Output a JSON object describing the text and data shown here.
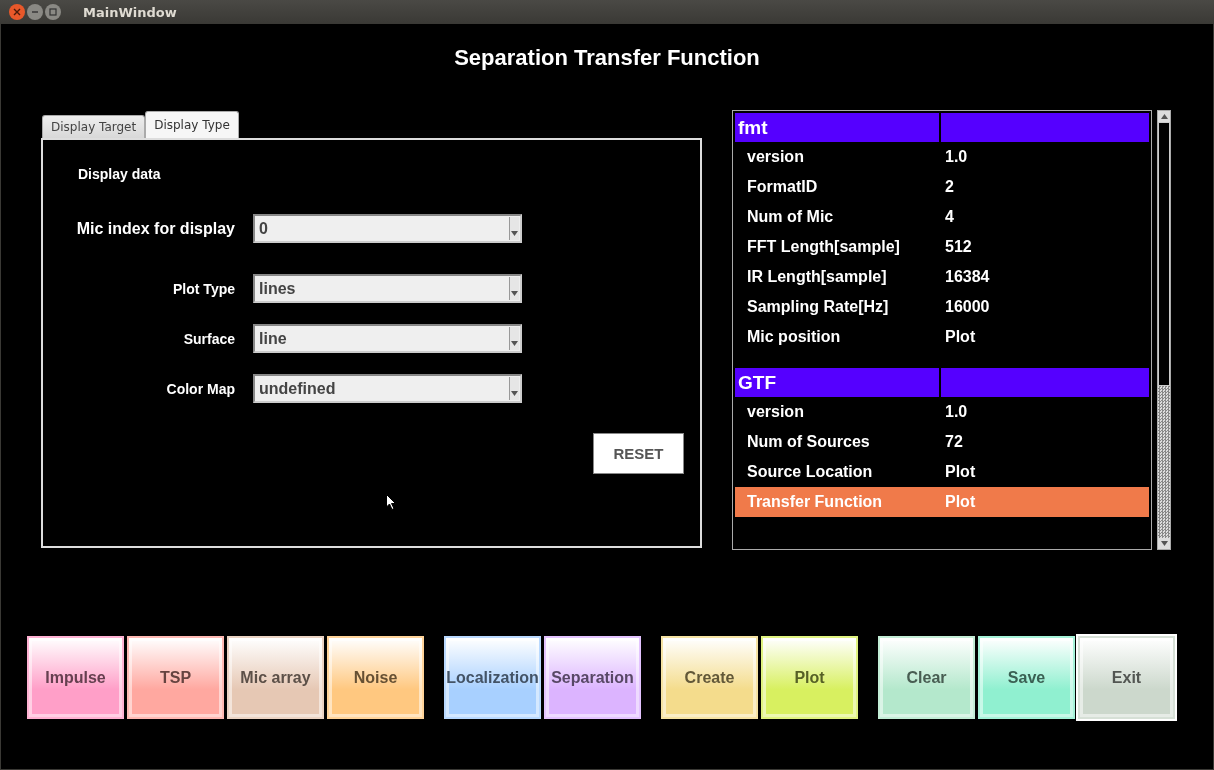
{
  "window": {
    "title": "MainWindow"
  },
  "heading": "Separation Transfer Function",
  "tabs": [
    {
      "label": "Display Target",
      "selected": false
    },
    {
      "label": "Display Type",
      "selected": true
    }
  ],
  "panel": {
    "section_label": "Display data",
    "fields": [
      {
        "label": "Mic index for display",
        "value": "0",
        "large": true
      },
      {
        "label": "Plot Type",
        "value": "lines",
        "large": false
      },
      {
        "label": "Surface",
        "value": "line",
        "large": false
      },
      {
        "label": "Color Map",
        "value": "undefined",
        "large": false
      }
    ],
    "reset_button": "RESET"
  },
  "table": {
    "sections": [
      {
        "title": "fmt",
        "rows": [
          {
            "name": "version",
            "value": "1.0",
            "selected": false
          },
          {
            "name": "FormatID",
            "value": "2",
            "selected": false
          },
          {
            "name": "Num of Mic",
            "value": "4",
            "selected": false
          },
          {
            "name": "FFT Length[sample]",
            "value": "512",
            "selected": false
          },
          {
            "name": "IR Length[sample]",
            "value": "16384",
            "selected": false
          },
          {
            "name": "Sampling Rate[Hz]",
            "value": "16000",
            "selected": false
          },
          {
            "name": "Mic position",
            "value": "Plot",
            "selected": false
          }
        ]
      },
      {
        "title": "GTF",
        "rows": [
          {
            "name": "version",
            "value": "1.0",
            "selected": false
          },
          {
            "name": "Num of Sources",
            "value": "72",
            "selected": false
          },
          {
            "name": "Source Location",
            "value": "Plot",
            "selected": false
          },
          {
            "name": "Transfer Function",
            "value": "Plot",
            "selected": true
          }
        ]
      }
    ]
  },
  "button_groups": [
    [
      {
        "label": "Impulse",
        "color": "#ff9fc8",
        "focused": false
      },
      {
        "label": "TSP",
        "color": "#ffa8a0",
        "focused": false
      },
      {
        "label": "Mic array",
        "color": "#e6c8b4",
        "focused": false
      },
      {
        "label": "Noise",
        "color": "#ffc880",
        "focused": false
      }
    ],
    [
      {
        "label": "Localization",
        "color": "#a8d0ff",
        "focused": false
      },
      {
        "label": "Separation",
        "color": "#dcb4ff",
        "focused": false
      }
    ],
    [
      {
        "label": "Create",
        "color": "#f4dc8c",
        "focused": false
      },
      {
        "label": "Plot",
        "color": "#d8f060",
        "focused": false
      }
    ],
    [
      {
        "label": "Clear",
        "color": "#b4e8cc",
        "focused": false
      },
      {
        "label": "Save",
        "color": "#90f0d0",
        "focused": false
      },
      {
        "label": "Exit",
        "color": "#ccd8cc",
        "focused": true
      }
    ]
  ]
}
